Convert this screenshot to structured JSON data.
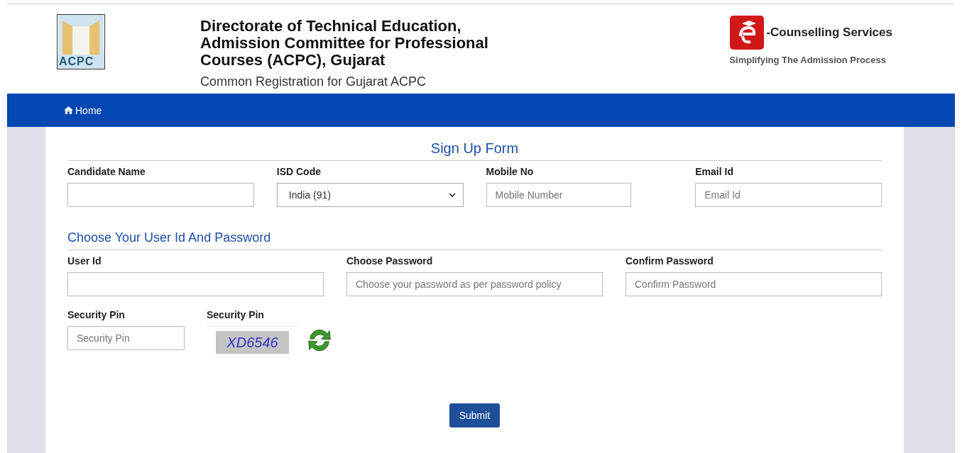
{
  "header": {
    "logo_text": "ACPC",
    "title": "Directorate of Technical Education, Admission Committee for Professional Courses (ACPC), Gujarat",
    "subtitle": "Common Registration for Gujarat ACPC",
    "brand": {
      "name": "-Counselling Services",
      "tagline": "Simplifying The Admission Process"
    }
  },
  "nav": [
    {
      "label": "Home"
    }
  ],
  "form": {
    "title": "Sign Up Form",
    "sections": [
      {
        "fields": [
          {
            "kind": "text",
            "label": "Candidate Name"
          },
          {
            "kind": "select",
            "label": "ISD Code",
            "value": "India (91)"
          },
          {
            "kind": "text",
            "label": "Mobile No",
            "placeholder": "Mobile Number"
          },
          {
            "kind": "text",
            "label": "Email Id",
            "placeholder": "Email Id"
          }
        ]
      },
      {
        "heading": "Choose Your User Id And Password",
        "fields": [
          {
            "kind": "text",
            "label": "User Id"
          },
          {
            "kind": "text",
            "label": "Choose Password",
            "placeholder": "Choose your password as per password policy"
          },
          {
            "kind": "text",
            "label": "Confirm Password",
            "placeholder": "Confirm Password"
          }
        ]
      },
      {
        "fields": [
          {
            "kind": "text",
            "label": "Security Pin",
            "placeholder": "Security Pin"
          },
          {
            "kind": "captcha",
            "label": "Security Pin",
            "code": "XD6546"
          }
        ]
      }
    ],
    "submit": "Submit"
  }
}
